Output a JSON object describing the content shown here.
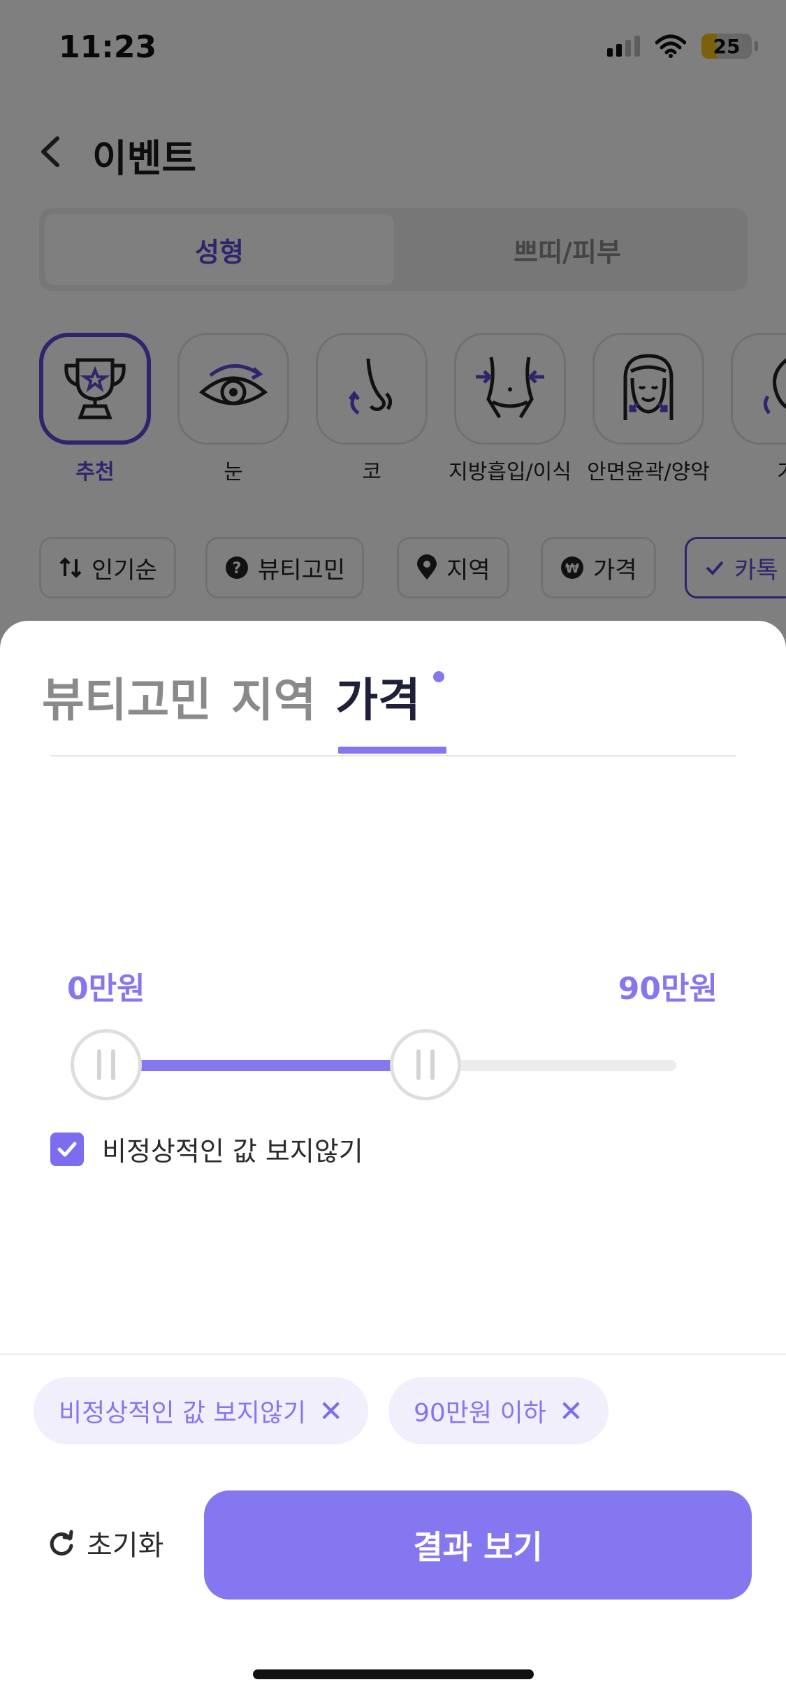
{
  "status": {
    "time": "11:23",
    "battery": "25"
  },
  "header": {
    "title": "이벤트"
  },
  "segments": [
    {
      "label": "성형"
    },
    {
      "label": "쁘띠/피부"
    }
  ],
  "categories": [
    {
      "label": "추천",
      "icon": "trophy-icon"
    },
    {
      "label": "눈",
      "icon": "eye-icon"
    },
    {
      "label": "코",
      "icon": "nose-icon"
    },
    {
      "label": "지방흡입/이식",
      "icon": "waist-icon"
    },
    {
      "label": "안면윤곽/양악",
      "icon": "face-icon"
    },
    {
      "label": "가",
      "icon": "chest-icon"
    }
  ],
  "filters": [
    {
      "label": "인기순",
      "icon": "sort-icon"
    },
    {
      "label": "뷰티고민",
      "icon": "question-icon"
    },
    {
      "label": "지역",
      "icon": "pin-icon"
    },
    {
      "label": "가격",
      "icon": "won-icon"
    },
    {
      "label": "카톡",
      "icon": "check-icon"
    }
  ],
  "sheet": {
    "tabs": [
      {
        "label": "뷰티고민"
      },
      {
        "label": "지역"
      },
      {
        "label": "가격"
      }
    ],
    "price_min_label": "0만원",
    "price_max_label": "90만원",
    "slider": {
      "min_fraction": 0.0,
      "max_fraction": 0.56
    },
    "checkbox_label": "비정상적인 값 보지않기",
    "checkbox_checked": true,
    "selected_tags": [
      {
        "label": "비정상적인 값 보지않기"
      },
      {
        "label": "90만원 이하"
      }
    ],
    "reset_label": "초기화",
    "submit_label": "결과 보기"
  },
  "colors": {
    "accent": "#5c4ad6",
    "accent_light": "#8577f0",
    "tag_bg": "#f1effc"
  }
}
